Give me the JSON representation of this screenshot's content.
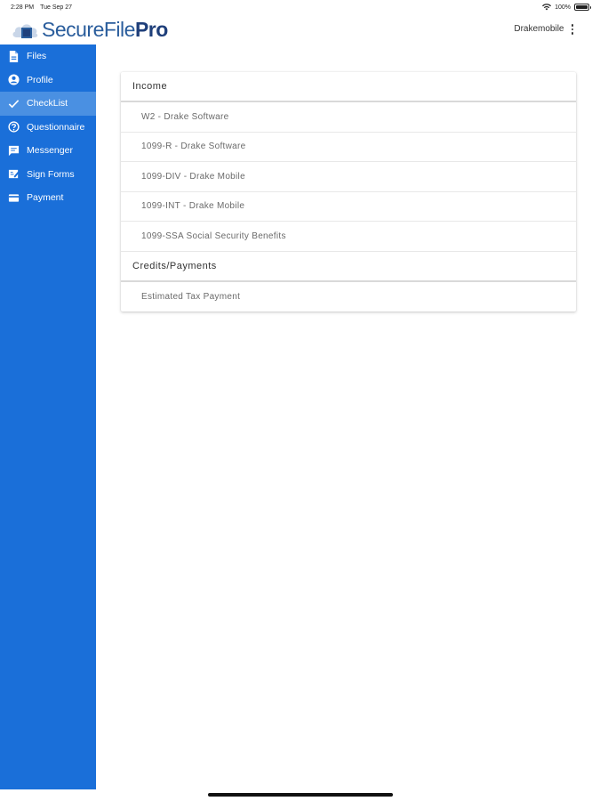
{
  "status_bar": {
    "time": "2:28 PM",
    "date": "Tue Sep 27",
    "battery": "100%"
  },
  "header": {
    "logo_main": "SecureFile",
    "logo_accent": "Pro",
    "username": "Drakemobile"
  },
  "sidebar": {
    "items": [
      {
        "label": "Files",
        "icon": "file-icon"
      },
      {
        "label": "Profile",
        "icon": "user-icon"
      },
      {
        "label": "CheckList",
        "icon": "check-icon",
        "active": true
      },
      {
        "label": "Questionnaire",
        "icon": "question-icon"
      },
      {
        "label": "Messenger",
        "icon": "chat-icon"
      },
      {
        "label": "Sign Forms",
        "icon": "sign-icon"
      },
      {
        "label": "Payment",
        "icon": "card-icon"
      }
    ]
  },
  "checklist": {
    "sections": [
      {
        "title": "Income",
        "items": [
          "W2 - Drake Software",
          "1099-R - Drake Software",
          "1099-DIV - Drake Mobile",
          "1099-INT - Drake Mobile",
          "1099-SSA Social Security Benefits"
        ]
      },
      {
        "title": "Credits/Payments",
        "items": [
          "Estimated Tax Payment"
        ]
      }
    ]
  },
  "colors": {
    "sidebar": "#1a6fd9",
    "sidebar_active": "#4a90e2",
    "brand": "#2a5d9c"
  }
}
